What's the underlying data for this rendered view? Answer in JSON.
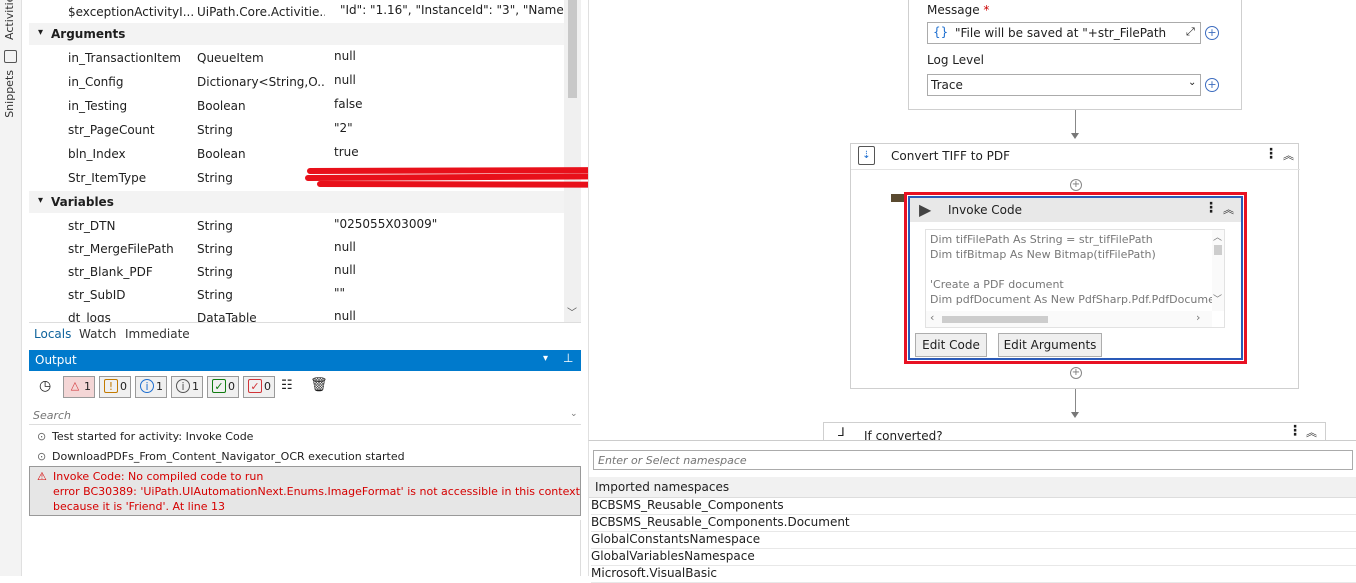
{
  "side_tabs": {
    "activities": "Activities",
    "snippets": "Snippets"
  },
  "locals": {
    "top_row": {
      "name": "$exceptionActivityI...",
      "type": "UiPath.Core.Activitie...",
      "value": "\"Id\": \"1.16\",  \"InstanceId\": \"3\",  \"Name\""
    },
    "arguments_title": "Arguments",
    "arguments": [
      {
        "name": "in_TransactionItem",
        "type": "QueueItem",
        "value": "null"
      },
      {
        "name": "in_Config",
        "type": "Dictionary<String,O...",
        "value": "null"
      },
      {
        "name": "in_Testing",
        "type": "Boolean",
        "value": "false"
      },
      {
        "name": "str_PageCount",
        "type": "String",
        "value": "\"2\""
      },
      {
        "name": "bln_Index",
        "type": "Boolean",
        "value": "true"
      },
      {
        "name": "Str_ItemType",
        "type": "String",
        "value": ""
      }
    ],
    "variables_title": "Variables",
    "variables": [
      {
        "name": "str_DTN",
        "type": "String",
        "value": "\"025055X03009\""
      },
      {
        "name": "str_MergeFilePath",
        "type": "String",
        "value": "null"
      },
      {
        "name": "str_Blank_PDF",
        "type": "String",
        "value": "null"
      },
      {
        "name": "str_SubID",
        "type": "String",
        "value": "\"\""
      },
      {
        "name": "dt_logs",
        "type": "DataTable",
        "value": "null"
      }
    ]
  },
  "debug_tabs": [
    "Locals",
    "Watch",
    "Immediate"
  ],
  "output": {
    "title": "Output",
    "filters": [
      {
        "icon": "error-icon",
        "count": "1",
        "color": "#d13438"
      },
      {
        "icon": "warning-icon",
        "count": "0",
        "color": "#c27a00"
      },
      {
        "icon": "info-icon",
        "count": "1",
        "color": "#1e6fd0"
      },
      {
        "icon": "trace-icon",
        "count": "1",
        "color": "#555555"
      },
      {
        "icon": "success-icon",
        "count": "0",
        "color": "#107c10"
      },
      {
        "icon": "check-icon",
        "count": "0",
        "color": "#d13438"
      }
    ],
    "search_placeholder": "Search",
    "messages": [
      "Test started for activity: Invoke Code",
      "DownloadPDFs_From_Content_Navigator_OCR execution started"
    ],
    "error_lines": [
      "Invoke Code: No compiled code to run",
      "error BC30389: 'UiPath.UIAutomationNext.Enums.ImageFormat' is not accessible in this context",
      "because it is 'Friend'. At line 13"
    ]
  },
  "designer": {
    "log": {
      "message_label": "Message",
      "required_mark": "*",
      "message_value": "\"File will be saved at  \"+str_FilePath",
      "level_label": "Log Level",
      "level_value": "Trace"
    },
    "sequence_title": "Convert TIFF to PDF",
    "invoke": {
      "title": "Invoke Code",
      "code_lines": [
        "Dim tifFilePath As String = str_tifFilePath",
        "Dim tifBitmap As New Bitmap(tifFilePath)",
        "",
        "'Create a PDF document",
        "Dim pdfDocument As New PdfSharp.Pdf.PdfDocume"
      ],
      "edit_code": "Edit Code",
      "edit_args": "Edit Arguments"
    },
    "if_title": "If converted?"
  },
  "namespaces": {
    "placeholder": "Enter or Select namespace",
    "header": "Imported namespaces",
    "items": [
      "BCBSMS_Reusable_Components",
      "BCBSMS_Reusable_Components.Document",
      "GlobalConstantsNamespace",
      "GlobalVariablesNamespace",
      "Microsoft.VisualBasic"
    ]
  },
  "colors": {
    "accent": "#007acc",
    "error": "#d50000",
    "highlight_border": "#e81123",
    "selection_border": "#2a5ab8",
    "redaction": "#e8101a"
  }
}
